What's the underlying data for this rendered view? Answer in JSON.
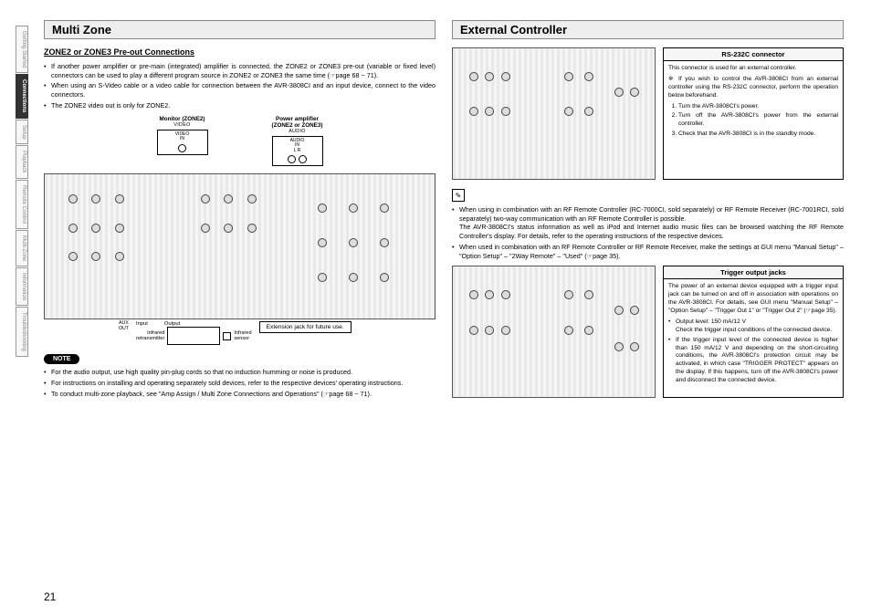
{
  "page_number": "21",
  "sidebar": {
    "tabs": [
      {
        "label": "Getting Started",
        "active": false
      },
      {
        "label": "Connections",
        "active": true
      },
      {
        "label": "Setup",
        "active": false
      },
      {
        "label": "Playback",
        "active": false
      },
      {
        "label": "Remote Control",
        "active": false
      },
      {
        "label": "Multi-Zone",
        "active": false
      },
      {
        "label": "Information",
        "active": false
      },
      {
        "label": "Troubleshooting",
        "active": false
      }
    ]
  },
  "left": {
    "title": "Multi Zone",
    "subtitle": "ZONE2 or ZONE3 Pre-out Connections",
    "bullets_top": [
      "If another power amplifier or pre-main (integrated) amplifier is connected, the ZONE2 or ZONE3 pre-out (variable or fixed level) connectors can be used to play a different program source in ZONE2 or ZONE3 the same time (☞page 68 ~ 71).",
      "When using an S-Video cable or a video cable for connection between the AVR-3808CI and an input device, connect to the video connectors.",
      "The ZONE2 video out is only for ZONE2."
    ],
    "monitor_label": "Monitor (ZONE2)",
    "amp_label_1": "Power amplifier",
    "amp_label_2": "(ZONE2 or ZONE3)",
    "video_label": "VIDEO",
    "audio_label": "AUDIO",
    "video_in": "VIDEO\nIN",
    "audio_in": "AUDIO\nIN",
    "lr": "L    R",
    "below_labels": {
      "aux": "AUX\nOUT",
      "input": "Input",
      "output": "Output",
      "ir_retx": "Infrared\nretransmitter",
      "ir_sensor": "Infrared\nsensor",
      "ext_jack": "Extension jack for future use."
    },
    "note_label": "NOTE",
    "note_bullets": [
      "For the audio output, use high quality pin-plug cords so that no induction humming or noise is produced.",
      "For instructions on installing and operating separately sold devices, refer to the respective devices' operating instructions.",
      "To conduct multi-zone playback, see \"Amp Assign / Multi Zone Connections and Operations\" (☞page 68 ~ 71)."
    ]
  },
  "right": {
    "title": "External Controller",
    "rs232": {
      "header": "RS-232C connector",
      "intro": "This connector is used for an external controller.",
      "star": "※ If you wish to control the AVR-3808CI from an external controller using the RS-232C connector, perform the operation below beforehand.",
      "steps": [
        "Turn the AVR-3808CI's power.",
        "Turn off the AVR-3808CI's power from the external controller.",
        "Check that the AVR-3808CI is in the standby mode."
      ]
    },
    "rf_bullets": [
      "When using in combination with an RF Remote Controller (RC-7000CI, sold separately) or RF Remote Receiver (RC-7001RCI, sold separately) two-way communication with an RF Remote Controller is possible.\nThe AVR-3808CI's status information as well as iPod and Internet audio music files can be browsed watching the RF Remote Controller's display. For details, refer to the operating instructions of the respective devices.",
      "When used in combination with an RF Remote Controller or RF Remote Receiver, make the settings at GUI menu \"Manual Setup\" – \"Option Setup\" – \"2Way Remote\" – \"Used\" (☞page 35)."
    ],
    "trigger": {
      "header": "Trigger output jacks",
      "p1": "The power of an external device equipped with a trigger input jack can be turned on and off in association with operations on the AVR-3808CI. For details, see GUI menu \"Manual Setup\" – \"Option Setup\" – \"Trigger Out 1\" or \"Trigger Out 2\" (☞page 35).",
      "b1": "Output level: 150 mA/12 V",
      "b1a": "Check the trigger input conditions of the connected device.",
      "b2": "If the trigger input level of the connected device is higher than 150 mA/12 V and depending on the short-circuiting conditions, the AVR-3808CI's protection circuit may be activated, in which case \"TRIGGER PROTECT\" appears on the display. If this happens, turn off the AVR-3808CI's power and disconnect the connected device."
    }
  }
}
